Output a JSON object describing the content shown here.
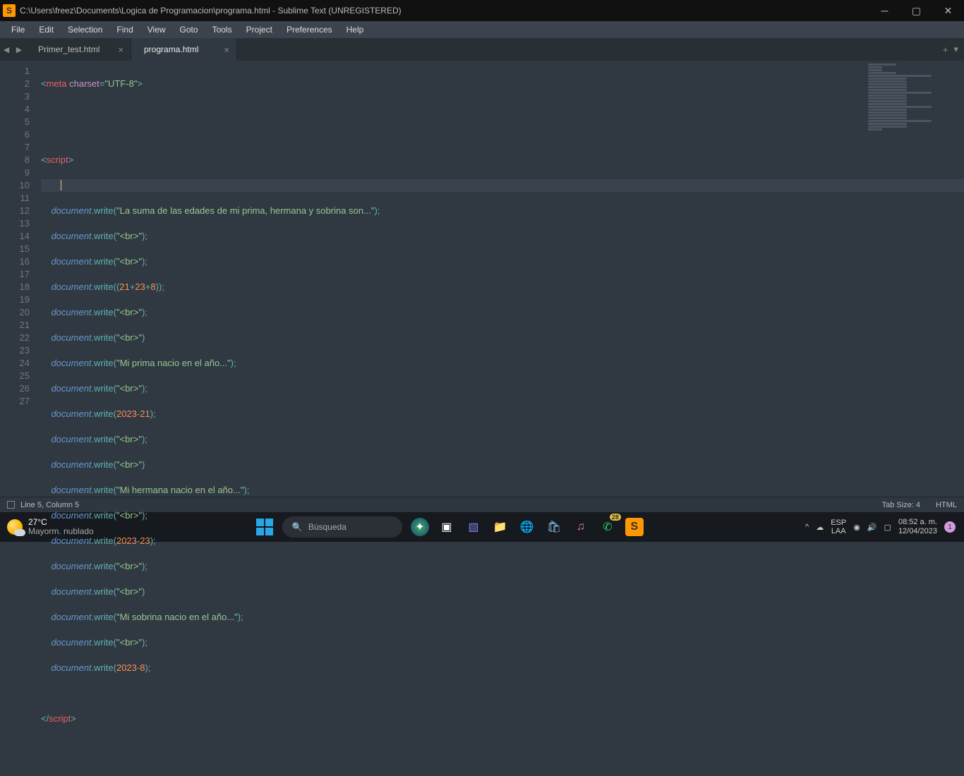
{
  "window": {
    "title": "C:\\Users\\freez\\Documents\\Logica de Programacion\\programa.html - Sublime Text (UNREGISTERED)"
  },
  "menubar": [
    "File",
    "Edit",
    "Selection",
    "Find",
    "View",
    "Goto",
    "Tools",
    "Project",
    "Preferences",
    "Help"
  ],
  "tabs": [
    {
      "label": "Primer_test.html",
      "active": false
    },
    {
      "label": "programa.html",
      "active": true
    }
  ],
  "status": {
    "pos": "Line 5, Column 5",
    "tab": "Tab Size: 4",
    "lang": "HTML"
  },
  "weather": {
    "temp": "27°C",
    "desc": "Mayorm. nublado"
  },
  "search_placeholder": "Búsqueda",
  "tray": {
    "lang1": "ESP",
    "lang2": "LAA",
    "time": "08:52 a. m.",
    "date": "12/04/2023",
    "notif": "1",
    "whatsapp_badge": "28"
  },
  "code": {
    "lines": 27,
    "l1": {
      "tag": "meta",
      "attr": "charset",
      "val": "\"UTF-8\""
    },
    "l4": {
      "tag": "script"
    },
    "l6": {
      "str": "\"La suma de las edades de mi prima, hermana y sobrina son...\""
    },
    "br": "\"<br>\"",
    "l9": {
      "a": "21",
      "b": "23",
      "c": "8"
    },
    "l12": {
      "str": "\"Mi prima nacio en el año...\""
    },
    "l14": {
      "a": "2023",
      "b": "21"
    },
    "l17": {
      "str": "\"Mi hermana nacio en el año...\""
    },
    "l19": {
      "a": "2023",
      "b": "23"
    },
    "l22": {
      "str": "\"Mi sobrina nacio en el año...\""
    },
    "l24": {
      "a": "2023",
      "b": "8"
    },
    "doc": "document",
    "write": "write"
  }
}
